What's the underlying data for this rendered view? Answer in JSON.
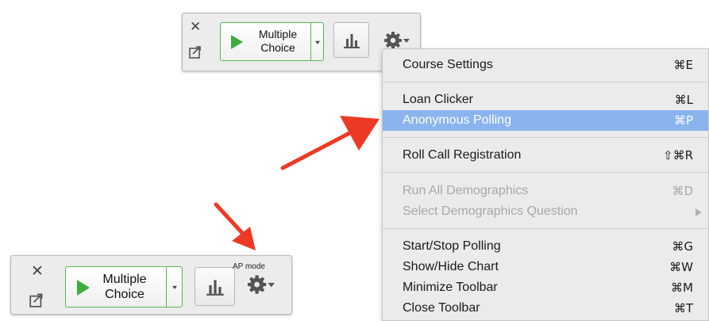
{
  "toolbar_top": {
    "play_label_line1": "Multiple",
    "play_label_line2": "Choice"
  },
  "toolbar_bottom": {
    "play_label_line1": "Multiple",
    "play_label_line2": "Choice",
    "ap_mode_label": "AP mode"
  },
  "menu": {
    "items": [
      {
        "label": "Course Settings",
        "shortcut": "⌘E"
      },
      {
        "label": "Loan Clicker",
        "shortcut": "⌘L"
      },
      {
        "label": "Anonymous Polling",
        "shortcut": "⌘P",
        "selected": true
      },
      {
        "label": "Roll Call Registration",
        "shortcut": "⇧⌘R"
      },
      {
        "label": "Run All Demographics",
        "shortcut": "⌘D",
        "disabled": true
      },
      {
        "label": "Select Demographics Question",
        "disabled": true,
        "submenu": true
      },
      {
        "label": "Start/Stop Polling",
        "shortcut": "⌘G"
      },
      {
        "label": "Show/Hide Chart",
        "shortcut": "⌘W"
      },
      {
        "label": "Minimize Toolbar",
        "shortcut": "⌘M"
      },
      {
        "label": "Close Toolbar",
        "shortcut": "⌘T"
      }
    ]
  },
  "icons": {
    "close": "close-icon",
    "export": "export-icon",
    "play": "play-icon",
    "dropdown": "chevron-down-icon",
    "chart": "bar-chart-icon",
    "gear": "gear-icon"
  },
  "colors": {
    "highlight": "#8ab4ee",
    "play_green": "#3cae3c",
    "arrow_red": "#ee3a24",
    "disabled_text": "#a8a8a8"
  }
}
